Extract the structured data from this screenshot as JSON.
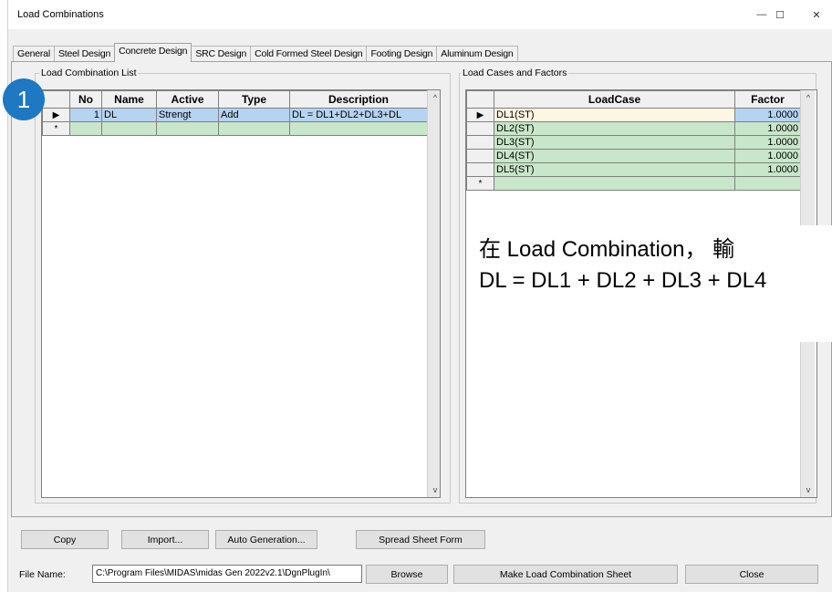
{
  "window": {
    "title": "Load Combinations",
    "minimize_glyph": "—",
    "maximize_glyph": "☐",
    "close_glyph": "✕"
  },
  "tabs": [
    {
      "label": "General",
      "active": false
    },
    {
      "label": "Steel Design",
      "active": false
    },
    {
      "label": "Concrete Design",
      "active": true
    },
    {
      "label": "SRC Design",
      "active": false
    },
    {
      "label": "Cold Formed Steel Design",
      "active": false
    },
    {
      "label": "Footing Design",
      "active": false
    },
    {
      "label": "Aluminum Design",
      "active": false
    }
  ],
  "combination_list": {
    "group_label": "Load Combination List",
    "columns": [
      "No",
      "Name",
      "Active",
      "Type",
      "Description"
    ],
    "rows": [
      {
        "marker": "▶",
        "no": "1",
        "name": "DL",
        "active": "Strengt",
        "type": "Add",
        "description": "DL = DL1+DL2+DL3+DL"
      }
    ],
    "new_row_marker": "*"
  },
  "load_cases": {
    "group_label": "Load Cases and Factors",
    "columns": [
      "LoadCase",
      "Factor"
    ],
    "rows": [
      {
        "marker": "▶",
        "loadcase": "DL1(ST)",
        "factor": "1.0000"
      },
      {
        "marker": "",
        "loadcase": "DL2(ST)",
        "factor": "1.0000"
      },
      {
        "marker": "",
        "loadcase": "DL3(ST)",
        "factor": "1.0000"
      },
      {
        "marker": "",
        "loadcase": "DL4(ST)",
        "factor": "1.0000"
      },
      {
        "marker": "",
        "loadcase": "DL5(ST)",
        "factor": "1.0000"
      }
    ],
    "new_row_marker": "*"
  },
  "scroll": {
    "up": "^",
    "down": "v"
  },
  "buttons": {
    "copy": "Copy",
    "import": "Import...",
    "auto_generation": "Auto Generation...",
    "spread_sheet_form": "Spread Sheet Form",
    "browse": "Browse",
    "make_sheet": "Make Load Combination Sheet",
    "close": "Close"
  },
  "file": {
    "label": "File Name:",
    "value": "C:\\Program Files\\MIDAS\\midas Gen 2022v2.1\\DgnPlugIn\\"
  },
  "annotation": {
    "badge": "1",
    "line1": "在 Load Combination， 輸",
    "line2": "DL = DL1 + DL2 + DL3 + DL4"
  },
  "colors": {
    "selected_row": "#b6d3f2",
    "new_row": "#c8e6c9",
    "badge": "#1e78c2"
  }
}
